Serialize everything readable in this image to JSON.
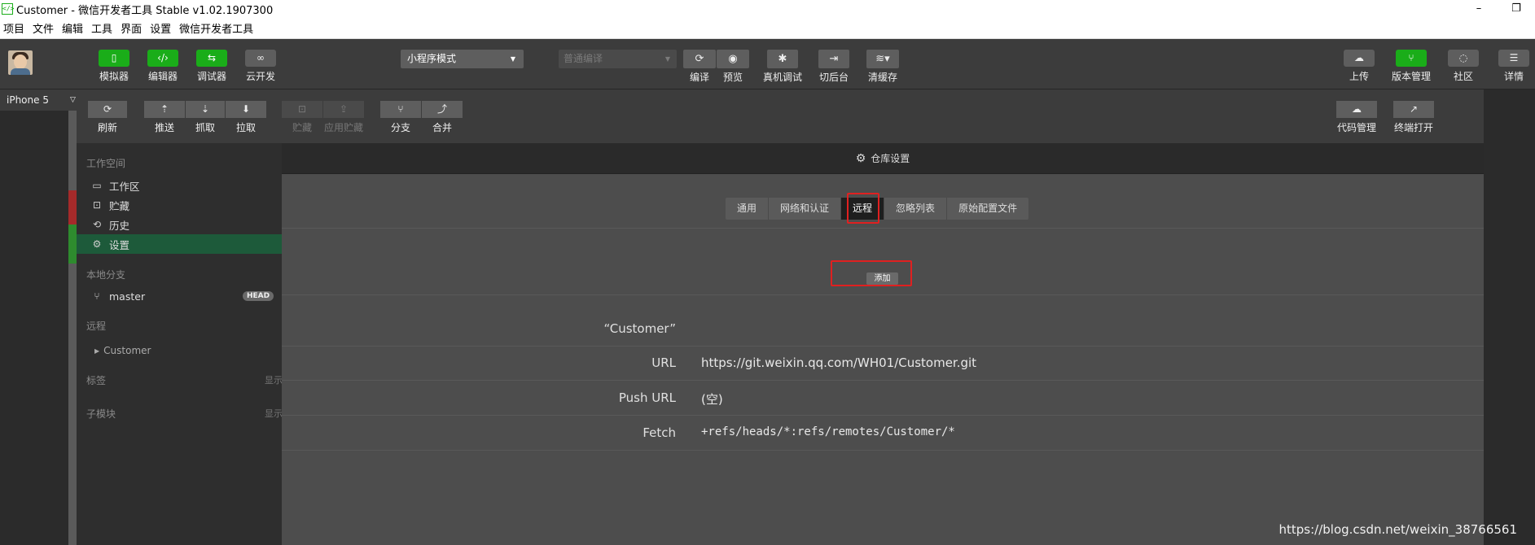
{
  "window": {
    "title": "Customer - 微信开发者工具 Stable v1.02.1907300",
    "minimize": "–",
    "restore": "❐"
  },
  "menu": [
    "项目",
    "文件",
    "编辑",
    "工具",
    "界面",
    "设置",
    "微信开发者工具"
  ],
  "toolbar": {
    "simulator": "模拟器",
    "editor": "编辑器",
    "debugger": "调试器",
    "cloud": "云开发",
    "mode": "小程序模式",
    "compile_mode": "普通编译",
    "compile": "编译",
    "preview": "预览",
    "remote_debug": "真机调试",
    "background": "切后台",
    "clear_cache": "清缓存",
    "upload": "上传",
    "version_mgmt": "版本管理",
    "community": "社区",
    "details": "详情"
  },
  "device": "iPhone 5",
  "git_toolbar": {
    "refresh": "刷新",
    "push": "推送",
    "fetch": "抓取",
    "pull": "拉取",
    "stash": "贮藏",
    "apply_stash": "应用贮藏",
    "branch": "分支",
    "merge": "合并",
    "code_mgmt": "代码管理",
    "terminal": "终端打开"
  },
  "sidebar": {
    "workspace_title": "工作空间",
    "workspace": [
      "工作区",
      "贮藏",
      "历史",
      "设置"
    ],
    "local_title": "本地分支",
    "branch": "master",
    "head_badge": "HEAD",
    "remote_title": "远程",
    "remote_item": "Customer",
    "tags_title": "标签",
    "tags_show": "显示",
    "submodule_title": "子模块",
    "submodule_show": "显示"
  },
  "header": {
    "title": "仓库设置"
  },
  "tabs": [
    "通用",
    "网络和认证",
    "远程",
    "忽略列表",
    "原始配置文件"
  ],
  "active_tab": "远程",
  "add_button": "添加",
  "remote": {
    "name": "“Customer”",
    "url_label": "URL",
    "url": "https://git.weixin.qq.com/WH01/Customer.git",
    "push_url_label": "Push URL",
    "push_url": "(空)",
    "fetch_label": "Fetch",
    "fetch": "+refs/heads/*:refs/remotes/Customer/*"
  },
  "watermark": "https://blog.csdn.net/weixin_38766561",
  "colors": {
    "accent": "#1aad19",
    "highlight": "#e02020",
    "selected": "#1d5a3a"
  }
}
